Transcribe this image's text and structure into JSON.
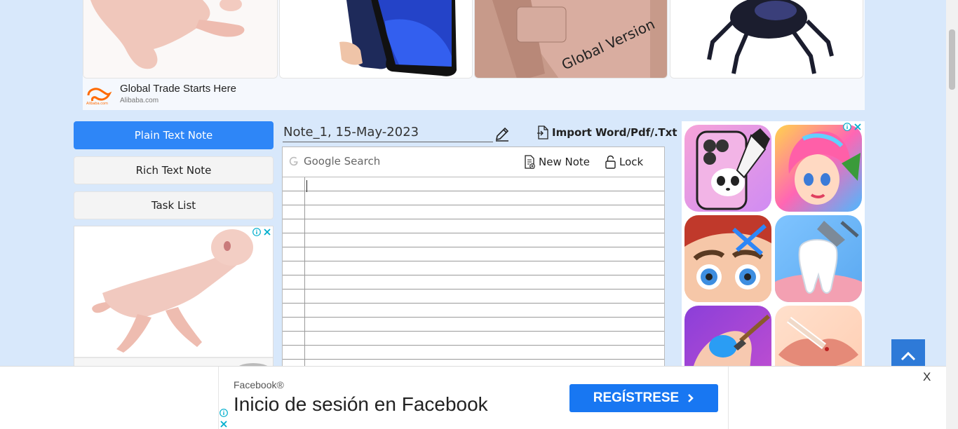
{
  "top_ad": {
    "brand_title": "Global Trade Starts Here",
    "brand_domain": "Alibaba.com",
    "tiles": [
      "baby-doll-product",
      "phone-product",
      "global-version-phone-case",
      "robot-spider-toy"
    ],
    "phone_case_text": "Global Version"
  },
  "sidebar": {
    "modes": [
      {
        "label": "Plain Text Note",
        "active": true
      },
      {
        "label": "Rich Text Note",
        "active": false
      },
      {
        "label": "Task List",
        "active": false
      }
    ]
  },
  "editor": {
    "note_title": "Note_1, 15-May-2023",
    "import_label": "Import Word/Pdf/.Txt",
    "google_search_placeholder": "Google Search",
    "new_note_label": "New Note",
    "lock_label": "Lock",
    "content": ""
  },
  "bottom_ad": {
    "brand": "Facebook®",
    "headline": "Inicio de sesión en Facebook",
    "cta_label": "REGÍSTRESE",
    "close_label": "X"
  },
  "colors": {
    "page_bg": "#d8e8fb",
    "primary": "#2e86f7",
    "facebook_blue": "#1877f2",
    "scroll_up_bg": "#2e7ad8"
  }
}
